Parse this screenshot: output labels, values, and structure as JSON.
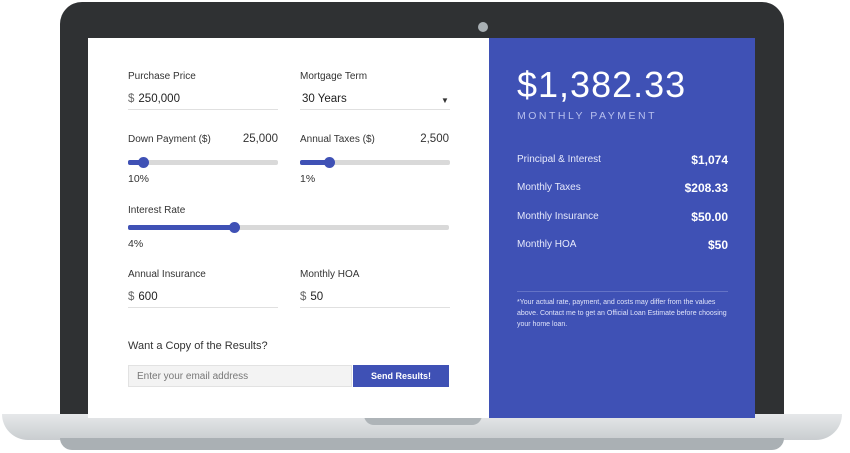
{
  "calculator": {
    "purchase_price": {
      "label": "Purchase Price",
      "currency": "$",
      "value": "250,000"
    },
    "mortgage_term": {
      "label": "Mortgage Term",
      "value": "30 Years",
      "caret": "▼"
    },
    "down_payment": {
      "label": "Down Payment ($)",
      "amount": "25,000",
      "percent": "10%",
      "level": 0.1
    },
    "annual_taxes": {
      "label": "Annual Taxes ($)",
      "amount": "2,500",
      "percent": "1%",
      "level": 0.19
    },
    "interest_rate": {
      "label": "Interest Rate",
      "percent": "4%",
      "level": 0.33
    },
    "annual_insurance": {
      "label": "Annual Insurance",
      "currency": "$",
      "value": "600"
    },
    "monthly_hoa": {
      "label": "Monthly HOA",
      "currency": "$",
      "value": "50"
    },
    "copy_heading": "Want a Copy of the Results?",
    "email_placeholder": "Enter your email address",
    "send_label": "Send Results!"
  },
  "results": {
    "monthly_payment": "$1,382.33",
    "monthly_payment_label": "MONTHLY PAYMENT",
    "rows": [
      {
        "label": "Principal & Interest",
        "value": "$1,074"
      },
      {
        "label": "Monthly Taxes",
        "value": "$208.33"
      },
      {
        "label": "Monthly Insurance",
        "value": "$50.00"
      },
      {
        "label": "Monthly HOA",
        "value": "$50"
      }
    ],
    "disclaimer": "*Your actual rate, payment, and costs may differ from the values above. Contact me to get an Official Loan Estimate before choosing your home loan."
  },
  "colors": {
    "accent": "#3f51b5",
    "laptop_frame": "#2f3133"
  }
}
